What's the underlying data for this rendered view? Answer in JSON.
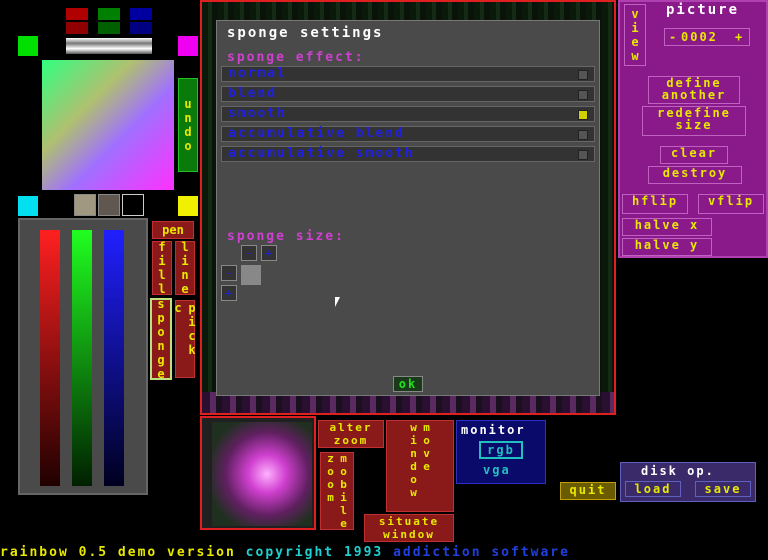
{
  "colors": {
    "accent_yellow": "#e8e800",
    "red_border": "#e02020",
    "magenta": "#8a1a8a",
    "blue_text": "#2020e0"
  },
  "dialog": {
    "title": "sponge settings",
    "effect_label": "sponge effect:",
    "options": [
      "normal",
      "blend",
      "smooth",
      "accumulative blend",
      "accumulative smooth"
    ],
    "selected_index": 2,
    "size_label": "sponge size:",
    "minus": "-",
    "plus": "+",
    "ok": "ok"
  },
  "tools": {
    "undo": "undo",
    "pen": "pen",
    "fill": "fill",
    "line": "line",
    "sponge": "sponge",
    "pick": "pick c"
  },
  "picture": {
    "view": "view",
    "title": "picture",
    "number": "0002",
    "minus": "-",
    "plus": "+",
    "define": "define another",
    "redefine": "redefine size",
    "clear": "clear",
    "destroy": "destroy",
    "hflip": "hflip",
    "vflip": "vflip",
    "halve_x": "halve x",
    "halve_y": "halve y"
  },
  "bottom": {
    "alter_zoom": "alter zoom",
    "mobile_zoom": "mobile zoom",
    "move_window": "move window",
    "situate_window": "situate window",
    "monitor": "monitor",
    "rgb": "rgb",
    "vga": "vga",
    "quit": "quit",
    "disk_op": "disk op.",
    "load": "load",
    "save": "save"
  },
  "footer": {
    "part1": "rainbow 0.5 demo version",
    "part2": "copyright 1993",
    "part3": "addiction software"
  }
}
